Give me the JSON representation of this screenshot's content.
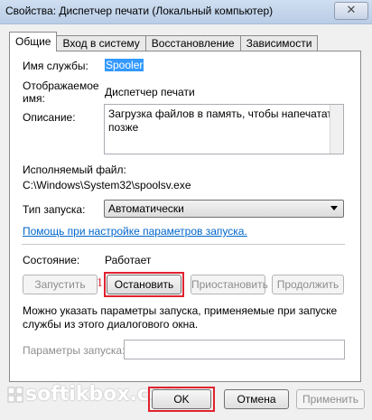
{
  "window": {
    "title": "Свойства: Диспетчер печати (Локальный компьютер)",
    "close_glyph": "✕"
  },
  "tabs": [
    {
      "label": "Общие",
      "active": true
    },
    {
      "label": "Вход в систему",
      "active": false
    },
    {
      "label": "Восстановление",
      "active": false
    },
    {
      "label": "Зависимости",
      "active": false
    }
  ],
  "general": {
    "service_name_label": "Имя службы:",
    "service_name_value": "Spooler",
    "display_name_label_1": "Отображаемое",
    "display_name_label_2": "имя:",
    "display_name_value": "Диспетчер печати",
    "description_label": "Описание:",
    "description_value": "Загрузка файлов в память, чтобы напечатать позже",
    "executable_label": "Исполняемый файл:",
    "executable_value": "C:\\Windows\\System32\\spoolsv.exe",
    "startup_type_label": "Тип запуска:",
    "startup_type_value": "Автоматически",
    "startup_help_link": "Помощь при настройке параметров запуска.",
    "status_label": "Состояние:",
    "status_value": "Работает",
    "buttons": {
      "start": "Запустить",
      "stop": "Остановить",
      "pause": "Приостановить",
      "resume": "Продолжить"
    },
    "annotation_marker": "1",
    "hint_line_1": "Можно указать параметры запуска, применяемые при запуске",
    "hint_line_2": "службы из этого диалогового окна.",
    "start_params_label": "Параметры запуска:",
    "start_params_value": ""
  },
  "footer": {
    "ok": "OK",
    "cancel": "Отмена",
    "apply": "Применить"
  },
  "watermark": {
    "text": "softikbox.com"
  },
  "colors": {
    "highlight": "#e0222e",
    "link": "#0066cc",
    "selection": "#3399ff"
  }
}
